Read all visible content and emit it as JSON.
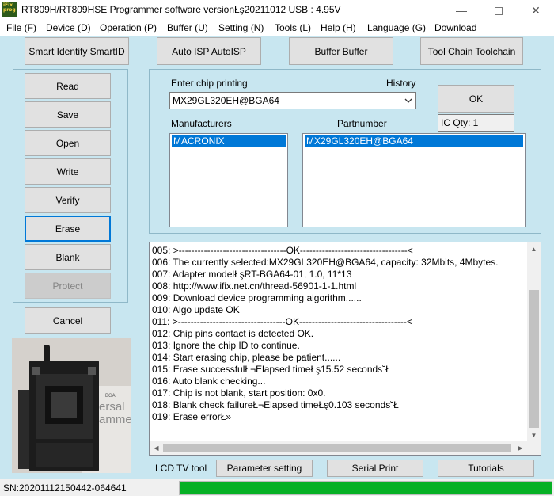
{
  "window": {
    "title": "RT809H/RT809HSE Programmer software versionŁş20211012  USB : 4.95V",
    "icon_text": "iFix prog"
  },
  "menu": [
    "File (F)",
    "Device (D)",
    "Operation (P)",
    "Buffer (U)",
    "Setting (N)",
    "Tools (L)",
    "Help (H)",
    "Language (G)",
    "Download"
  ],
  "toolbar": {
    "smart_id": "Smart Identify SmartID",
    "auto_isp": "Auto ISP AutoISP",
    "buffer": "Buffer Buffer",
    "toolchain": "Tool Chain Toolchain"
  },
  "actions": {
    "read": "Read",
    "save": "Save",
    "open": "Open",
    "write": "Write",
    "verify": "Verify",
    "erase": "Erase",
    "blank": "Blank",
    "protect": "Protect",
    "cancel": "Cancel"
  },
  "chip": {
    "enter_label": "Enter chip printing",
    "history_label": "History",
    "selected": "MX29GL320EH@BGA64",
    "ok": "OK",
    "ic_qty": "IC Qty: 1",
    "manufacturers_label": "Manufacturers",
    "partnumber_label": "Partnumber",
    "manufacturer_selected": "MACRONIX",
    "partnumber_selected": "MX29GL320EH@BGA64"
  },
  "device_image": {
    "text1": "ersal",
    "text2": "amme",
    "text3": "BGA"
  },
  "log": [
    "005:  >----------------------------------OK----------------------------------<",
    "006:  The currently selected:MX29GL320EH@BGA64, capacity: 32Mbits, 4Mbytes.",
    "007:  Adapter modelŁşRT-BGA64-01, 1.0, 11*13",
    "008:  http://www.ifix.net.cn/thread-56901-1-1.html",
    "009:  Download device programming algorithm......",
    "010:  Algo update OK",
    "011:  >----------------------------------OK----------------------------------<",
    "012:  Chip pins contact is detected OK.",
    "013:  Ignore the chip ID to continue.",
    "014:  Start erasing chip, please be patient......",
    "015:  Erase successfulŁ¬Elapsed timeŁş15.52 seconds˘Ł",
    "016:  Auto blank checking...",
    "017:  Chip is not blank, start position: 0x0.",
    "018:  Blank check failureŁ¬Elapsed timeŁş0.103 seconds˘Ł",
    "019:  Erase errorŁ»"
  ],
  "bottom": {
    "lcd_tv": "LCD TV tool",
    "parameter": "Parameter setting",
    "serial": "Serial Print",
    "tutorials": "Tutorials"
  },
  "status": {
    "sn": "SN:20201112150442-064641",
    "progress": 1.0,
    "progress_color": "#06b025"
  }
}
